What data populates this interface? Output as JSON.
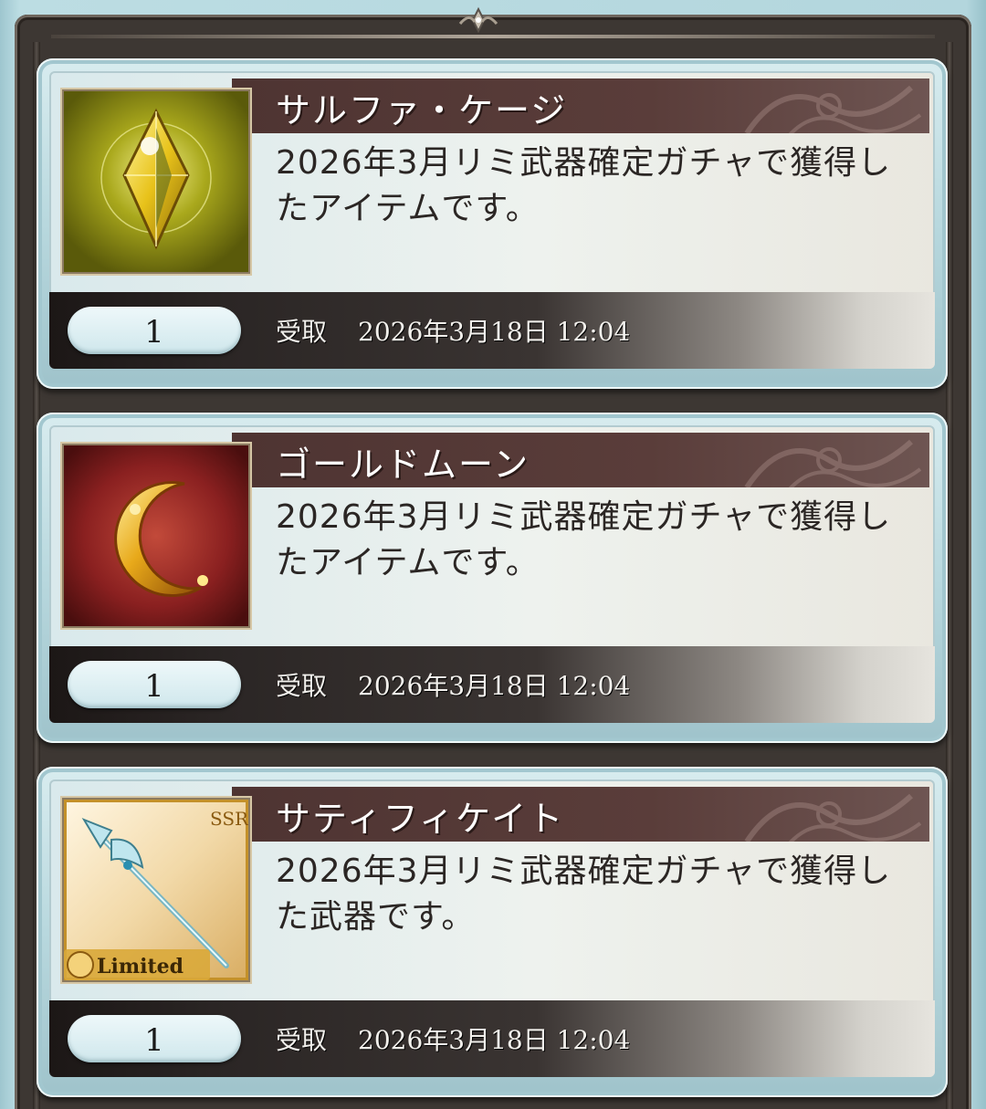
{
  "items": [
    {
      "name": "サルファ・ケージ",
      "description": "2026年3月リミ武器確定ガチャで獲得したアイテムです。",
      "quantity": "1",
      "status": "受取",
      "date": "2026年3月18日 12:04",
      "icon": "yellow-crystal-icon"
    },
    {
      "name": "ゴールドムーン",
      "description": "2026年3月リミ武器確定ガチャで獲得したアイテムです。",
      "quantity": "1",
      "status": "受取",
      "date": "2026年3月18日 12:04",
      "icon": "gold-moon-icon"
    },
    {
      "name": "サティフィケイト",
      "description": "2026年3月リミ武器確定ガチャで獲得した武器です。",
      "quantity": "1",
      "status": "受取",
      "date": "2026年3月18日 12:04",
      "icon": "spear-weapon-icon",
      "rarity": "SSR",
      "badge": "Limited"
    }
  ],
  "colors": {
    "title_bar": "#4e3432",
    "card_border": "#b8d8de",
    "frame": "#3d3733"
  }
}
